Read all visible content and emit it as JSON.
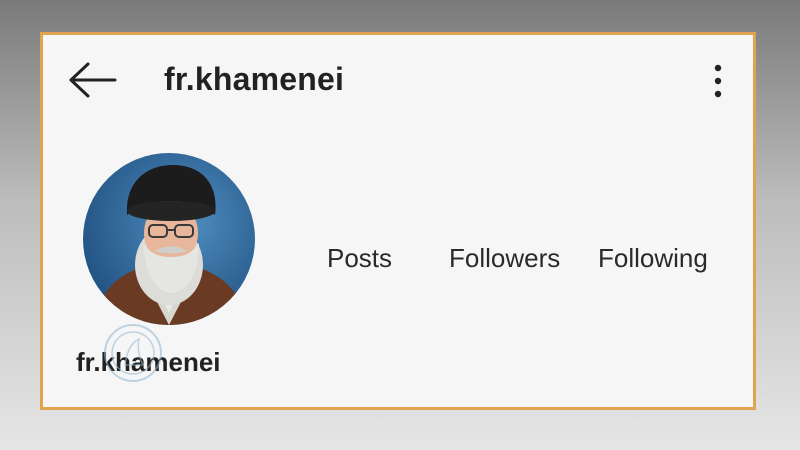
{
  "header": {
    "back_icon": "arrow-left-icon",
    "username": "fr.khamenei",
    "menu_icon": "more-vertical-icon"
  },
  "profile": {
    "avatar_icon": "profile-photo",
    "stats": [
      {
        "label": "Posts"
      },
      {
        "label": "Followers"
      },
      {
        "label": "Following"
      }
    ],
    "display_name": "fr.khamenei"
  },
  "colors": {
    "frame_border": "#e0a450",
    "card_background": "#f6f6f6",
    "text": "#222222"
  }
}
